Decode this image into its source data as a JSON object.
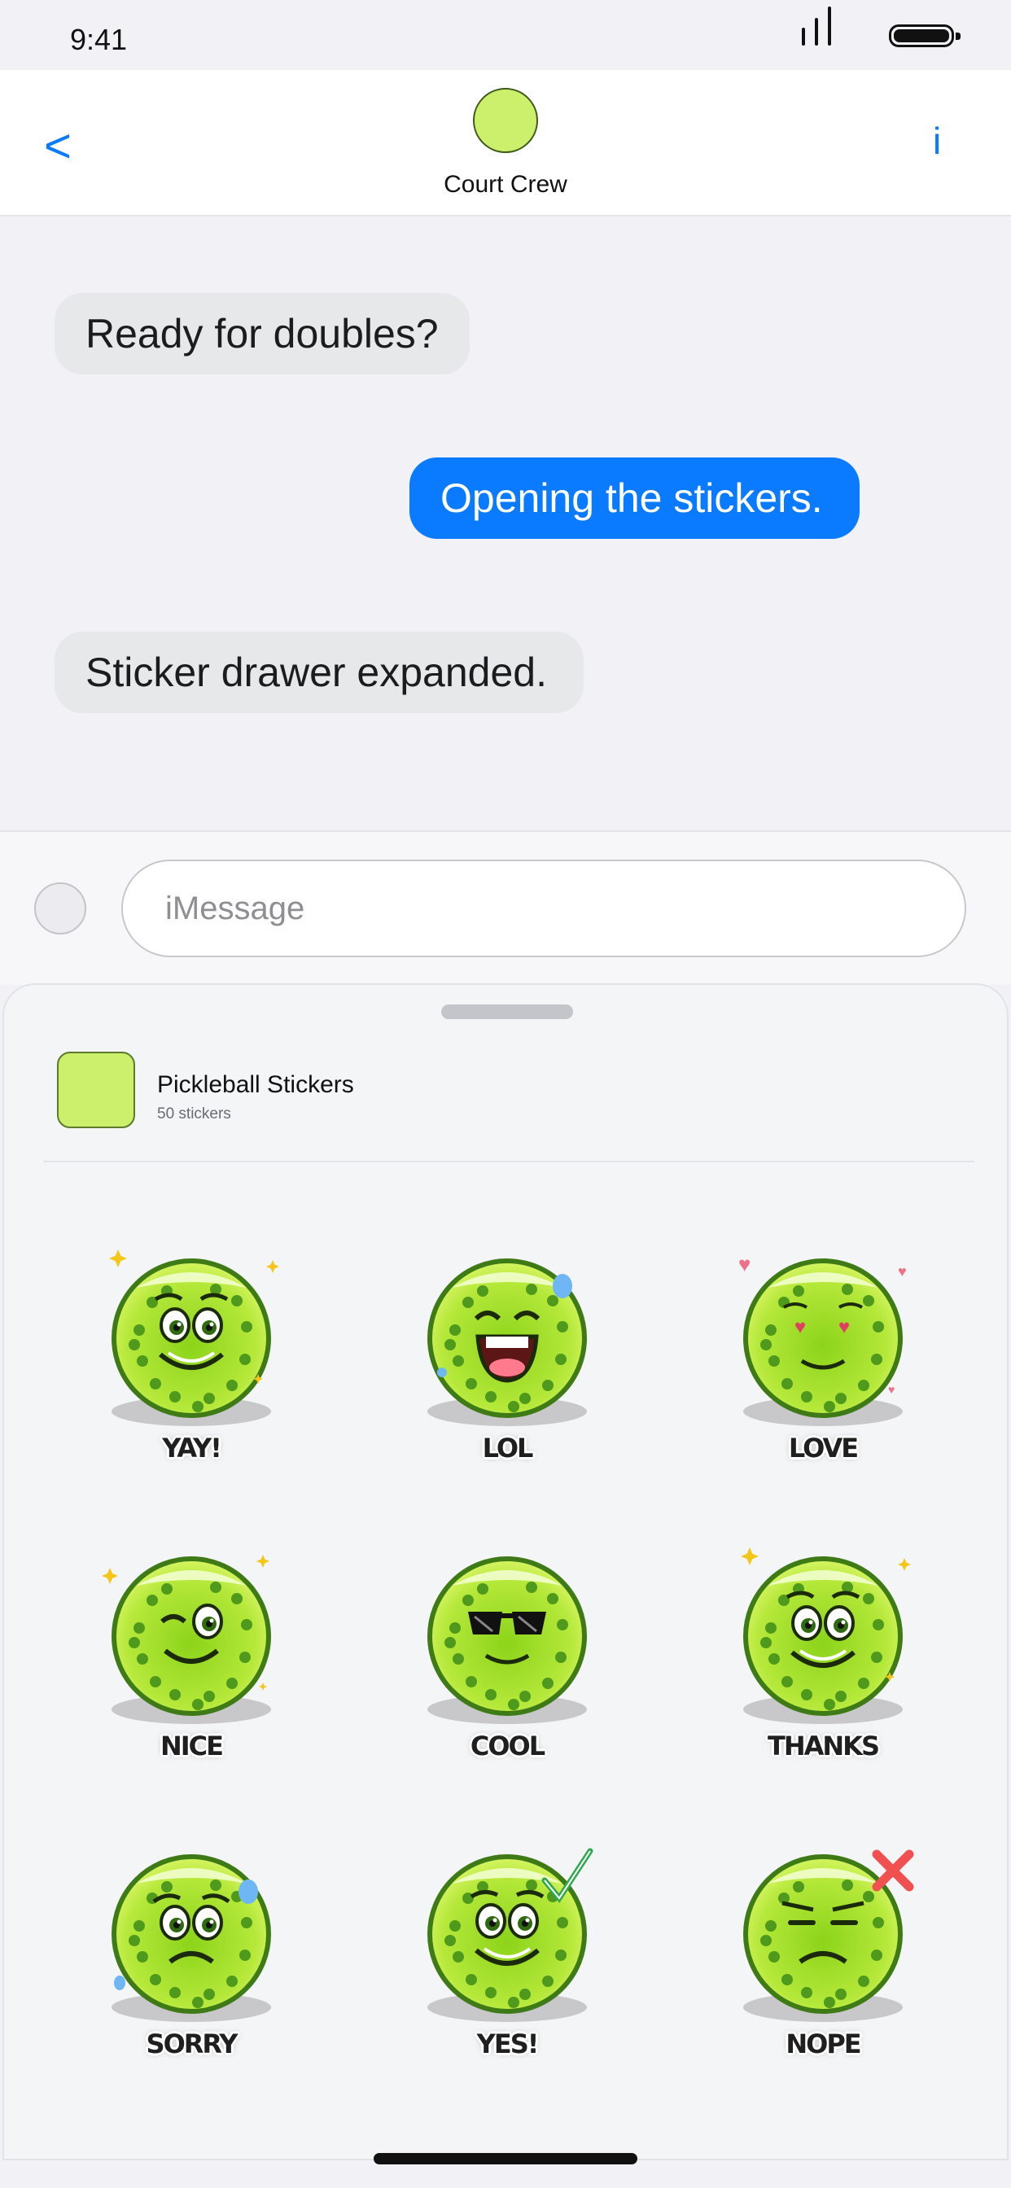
{
  "status_bar": {
    "time": "9:41"
  },
  "header": {
    "back_label": "<",
    "contact_name": "Court Crew",
    "info_label": "i"
  },
  "messages": [
    {
      "text": "Ready for doubles?",
      "direction": "incoming"
    },
    {
      "text": "Opening the stickers.",
      "direction": "outgoing"
    },
    {
      "text": "Sticker drawer expanded.",
      "direction": "incoming"
    }
  ],
  "composer": {
    "placeholder": "iMessage"
  },
  "sticker_pack": {
    "title": "Pickleball Stickers",
    "count": "50 stickers"
  },
  "stickers": [
    {
      "label": "YAY!",
      "expression": "happy-sparkles"
    },
    {
      "label": "LOL",
      "expression": "laughing"
    },
    {
      "label": "LOVE",
      "expression": "hearts"
    },
    {
      "label": "NICE",
      "expression": "wink"
    },
    {
      "label": "COOL",
      "expression": "sunglasses"
    },
    {
      "label": "THANKS",
      "expression": "grateful"
    },
    {
      "label": "SORRY",
      "expression": "sad-sweat"
    },
    {
      "label": "YES!",
      "expression": "checkmark"
    },
    {
      "label": "NOPE",
      "expression": "cross"
    }
  ],
  "colors": {
    "accent": "#0a7aff",
    "outgoing_bubble": "#0a7aff",
    "incoming_bubble": "#e6e8ea",
    "ball_green": "#a8de1e",
    "ball_dark": "#3e7a16"
  }
}
